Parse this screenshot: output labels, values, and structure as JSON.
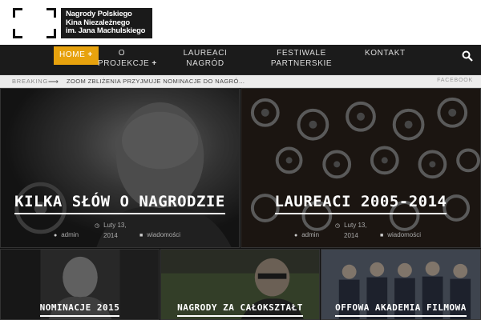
{
  "header": {
    "logo_lines": [
      "Nagrody Polskiego",
      "Kina Niezależnego",
      "im. Jana Machulskiego"
    ]
  },
  "nav": {
    "items": [
      {
        "label": "HOME",
        "has_plus": true,
        "active": true
      },
      {
        "label_lines": [
          "O",
          "PROJEKCJE"
        ],
        "has_plus": true
      },
      {
        "label_lines": [
          "LAUREACI",
          "NAGRÓD"
        ]
      },
      {
        "label_lines": [
          "FESTIWALE",
          "PARTNERSKIE"
        ]
      },
      {
        "label": "KONTAKT"
      }
    ],
    "plus_symbol": "+",
    "search_icon": "search-icon"
  },
  "breaking": {
    "label": "BREAKING",
    "arrow": "⟶",
    "headline": "ZOOM ZBLIŻENIA PRZYJMUJE NOMINACJE DO NAGRÓ…",
    "social": "FACEBOOK"
  },
  "featured": [
    {
      "title": "KILKA SŁÓW O NAGRODZIE",
      "date_lines": [
        "Luty 13,",
        "2014"
      ],
      "author": "admin",
      "category": "wiadomości"
    },
    {
      "title": "LAUREACI 2005-2014",
      "date_lines": [
        "Luty 13,",
        "2014"
      ],
      "author": "admin",
      "category": "wiadomości"
    }
  ],
  "posts": [
    {
      "title": "NOMINACJE 2015"
    },
    {
      "title": "NAGRODY ZA CAŁOKSZTAŁT"
    },
    {
      "title": "OFFOWA AKADEMIA FILMOWA"
    }
  ],
  "colors": {
    "accent": "#e7a20d",
    "nav_bg": "#1b1b1b",
    "breaking_bg": "#ececec"
  }
}
